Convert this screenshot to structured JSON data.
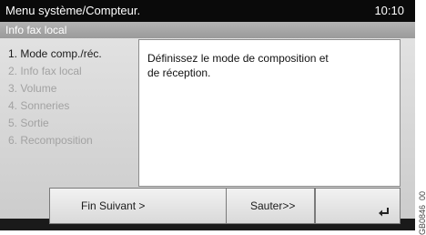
{
  "header": {
    "title": "Menu système/Compteur.",
    "time": "10:10"
  },
  "subheader": {
    "label": "Info fax local"
  },
  "menu": {
    "items": [
      {
        "label": "1. Mode comp./réc.",
        "active": true
      },
      {
        "label": "2. Info fax local",
        "active": false
      },
      {
        "label": "3. Volume",
        "active": false
      },
      {
        "label": "4. Sonneries",
        "active": false
      },
      {
        "label": "5. Sortie",
        "active": false
      },
      {
        "label": "6. Recomposition",
        "active": false
      }
    ]
  },
  "description": {
    "line1": "Définissez le mode de composition et",
    "line2": "de réception."
  },
  "buttons": {
    "end_next": "Fin Suivant >",
    "skip": "Sauter>>"
  },
  "side_code": "GB0846_00",
  "icons": {
    "enter": "enter-icon"
  }
}
